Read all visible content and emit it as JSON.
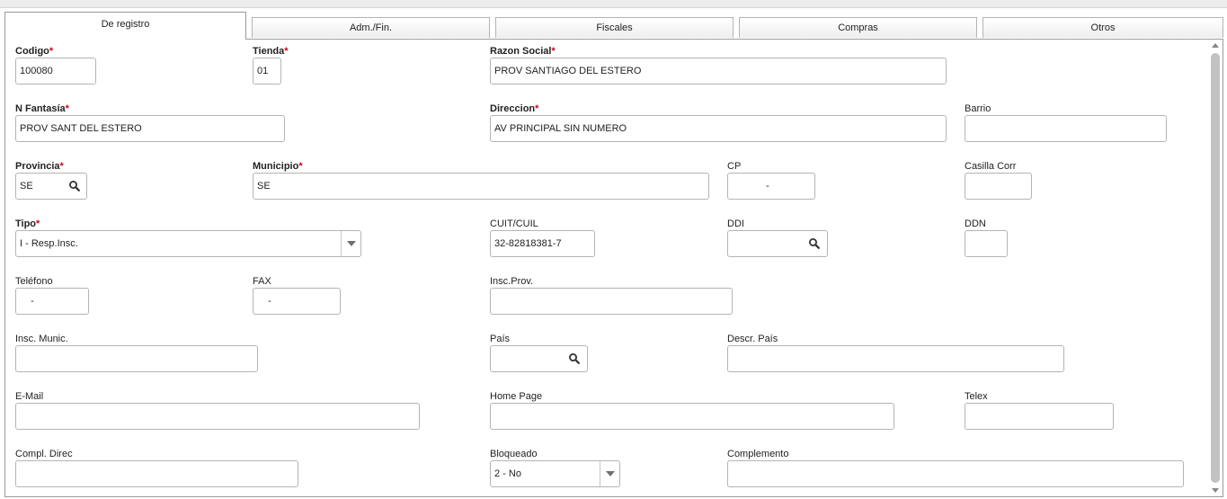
{
  "tabs": [
    "De registro",
    "Adm./Fin.",
    "Fiscales",
    "Compras",
    "Otros"
  ],
  "fields": {
    "codigo": {
      "label": "Codigo",
      "value": "100080"
    },
    "tienda": {
      "label": "Tienda",
      "value": "01"
    },
    "razon_social": {
      "label": "Razon Social",
      "value": "PROV SANTIAGO DEL ESTERO"
    },
    "n_fantasia": {
      "label": "N Fantasía",
      "value": "PROV SANT DEL ESTERO"
    },
    "direccion": {
      "label": "Direccion",
      "value": "AV PRINCIPAL SIN NUMERO"
    },
    "barrio": {
      "label": "Barrio",
      "value": ""
    },
    "provincia": {
      "label": "Provincia",
      "value": "SE"
    },
    "municipio": {
      "label": "Municipio",
      "value": "SE"
    },
    "cp": {
      "label": "CP",
      "value": "-"
    },
    "casilla_corr": {
      "label": "Casilla Corr",
      "value": ""
    },
    "tipo": {
      "label": "Tipo",
      "value": "I - Resp.Insc."
    },
    "cuit_cuil": {
      "label": "CUIT/CUIL",
      "value": "32-82818381-7"
    },
    "ddi": {
      "label": "DDI",
      "value": ""
    },
    "ddn": {
      "label": "DDN",
      "value": ""
    },
    "telefono": {
      "label": "Teléfono",
      "value": "-"
    },
    "fax": {
      "label": "FAX",
      "value": "-"
    },
    "insc_prov": {
      "label": "Insc.Prov.",
      "value": ""
    },
    "insc_munic": {
      "label": "Insc. Munic.",
      "value": ""
    },
    "pais": {
      "label": "País",
      "value": ""
    },
    "descr_pais": {
      "label": "Descr. País",
      "value": ""
    },
    "email": {
      "label": "E-Mail",
      "value": ""
    },
    "home_page": {
      "label": "Home Page",
      "value": ""
    },
    "telex": {
      "label": "Telex",
      "value": ""
    },
    "compl_direc": {
      "label": "Compl. Direc",
      "value": ""
    },
    "bloqueado": {
      "label": "Bloqueado",
      "value": "2 - No"
    },
    "complemento": {
      "label": "Complemento",
      "value": ""
    }
  },
  "required_marker": "*",
  "icons": {
    "lookup": "search-icon",
    "dropdown": "chevron-down-icon"
  },
  "colors": {
    "required": "#d0021b",
    "border": "#b4b4b4",
    "scroll_thumb": "#c2c2c2"
  }
}
